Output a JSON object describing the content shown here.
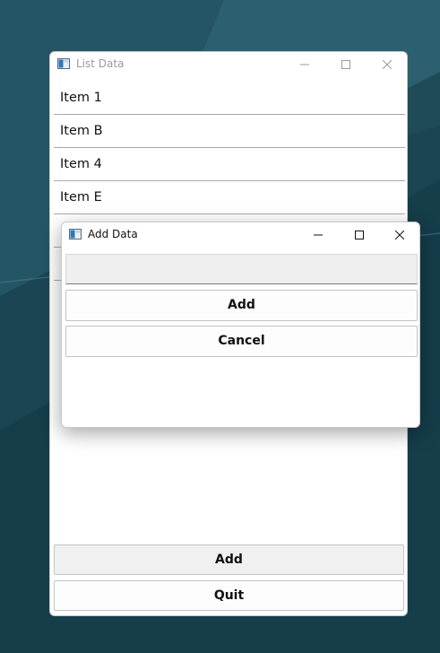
{
  "main_window": {
    "title": "List Data",
    "items": [
      {
        "label": "Item 1"
      },
      {
        "label": "Item B"
      },
      {
        "label": "Item 4"
      },
      {
        "label": "Item E"
      },
      {
        "label": ""
      },
      {
        "label": ""
      }
    ],
    "add_label": "Add",
    "quit_label": "Quit"
  },
  "dialog": {
    "title": "Add Data",
    "input_value": "",
    "add_label": "Add",
    "cancel_label": "Cancel"
  },
  "icons": {
    "app": "app-window-icon",
    "minimize": "minimize-icon",
    "maximize": "maximize-icon",
    "close": "close-icon"
  },
  "colors": {
    "desktop_background": "#1d4a58",
    "window_background": "#ffffff",
    "inactive_title": "#9a9a9a",
    "list_divider": "#a9a9a9"
  }
}
